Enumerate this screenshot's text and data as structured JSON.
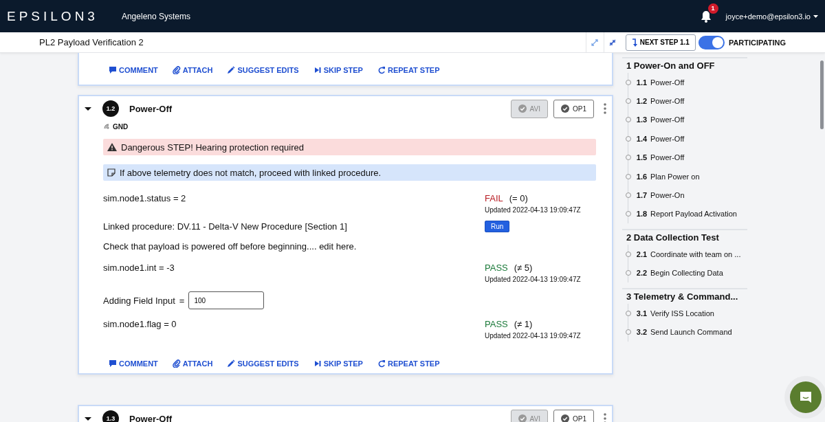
{
  "app": {
    "logo": "EPSILON3",
    "org": "Angeleno Systems",
    "notifications": "1",
    "user": "joyce+demo@epsilon3.io"
  },
  "procedure_bar": {
    "title": "PL2 Payload Verification 2",
    "next_step": "NEXT STEP 1.1",
    "participating": {
      "label": "PARTICIPATING",
      "on": true
    }
  },
  "steps": [
    {
      "kind": "tail",
      "actions": [
        {
          "kind": "comment",
          "label": "COMMENT"
        },
        {
          "kind": "attach",
          "label": "ATTACH"
        },
        {
          "kind": "edit",
          "label": "SUGGEST EDITS"
        },
        {
          "kind": "skip",
          "label": "SKIP STEP"
        },
        {
          "kind": "repeat",
          "label": "REPEAT STEP"
        }
      ]
    },
    {
      "kind": "full",
      "expanded": true,
      "number": "1.2",
      "title": "Power-Off",
      "signoffs": [
        {
          "label": "AVI",
          "disabled": true
        },
        {
          "label": "OP1",
          "disabled": false
        }
      ],
      "tag": "GND",
      "alerts": [
        {
          "kind": "warning",
          "text": "Dangerous STEP! Hearing protection required"
        },
        {
          "kind": "note",
          "text": "If above telemetry does not match, proceed with linked procedure."
        }
      ],
      "content": [
        {
          "kind": "telemetry",
          "expression": "sim.node1.status = 2",
          "result": "FAIL",
          "passed": false,
          "rule": "(= 0)",
          "updated_label": "Updated",
          "updated": "2022-04-13 19:09:47Z"
        },
        {
          "kind": "link",
          "text": "Linked procedure: DV.11 - Delta-V New Procedure [Section 1]",
          "button": "Run"
        },
        {
          "kind": "text",
          "text": "Check that payload is powered off before beginning.... edit here."
        },
        {
          "kind": "telemetry",
          "expression": "sim.node1.int = -3",
          "result": "PASS",
          "passed": true,
          "rule": "(≠ 5)",
          "updated_label": "Updated",
          "updated": "2022-04-13 19:09:47Z"
        },
        {
          "kind": "field",
          "label": "Adding Field Input",
          "equals": "=",
          "value": "100"
        },
        {
          "kind": "telemetry",
          "expression": "sim.node1.flag = 0",
          "result": "PASS",
          "passed": true,
          "rule": "(≠ 1)",
          "updated_label": "Updated",
          "updated": "2022-04-13 19:09:47Z"
        }
      ],
      "actions": [
        {
          "kind": "comment",
          "label": "COMMENT"
        },
        {
          "kind": "attach",
          "label": "ATTACH"
        },
        {
          "kind": "edit",
          "label": "SUGGEST EDITS"
        },
        {
          "kind": "skip",
          "label": "SKIP STEP"
        },
        {
          "kind": "repeat",
          "label": "REPEAT STEP"
        }
      ]
    },
    {
      "kind": "head",
      "expanded": true,
      "number": "1.3",
      "title": "Power-Off",
      "signoffs": [
        {
          "label": "AVI",
          "disabled": true
        },
        {
          "label": "OP1",
          "disabled": false
        }
      ]
    }
  ],
  "outline": [
    {
      "title": "1 Power-On and OFF",
      "steps": [
        {
          "number": "1.1",
          "title": "Power-Off"
        },
        {
          "number": "1.2",
          "title": "Power-Off"
        },
        {
          "number": "1.3",
          "title": "Power-Off"
        },
        {
          "number": "1.4",
          "title": "Power-Off"
        },
        {
          "number": "1.5",
          "title": "Power-Off"
        },
        {
          "number": "1.6",
          "title": "Plan Power on"
        },
        {
          "number": "1.7",
          "title": "Power-On"
        },
        {
          "number": "1.8",
          "title": "Report Payload Activation"
        }
      ]
    },
    {
      "title": "2 Data Collection Test",
      "steps": [
        {
          "number": "2.1",
          "title": "Coordinate with team on ..."
        },
        {
          "number": "2.2",
          "title": "Begin Collecting Data"
        }
      ]
    },
    {
      "title": "3 Telemetry & Command...",
      "steps": [
        {
          "number": "3.1",
          "title": "Verify ISS Location"
        },
        {
          "number": "3.2",
          "title": "Send Launch Command"
        }
      ]
    }
  ]
}
